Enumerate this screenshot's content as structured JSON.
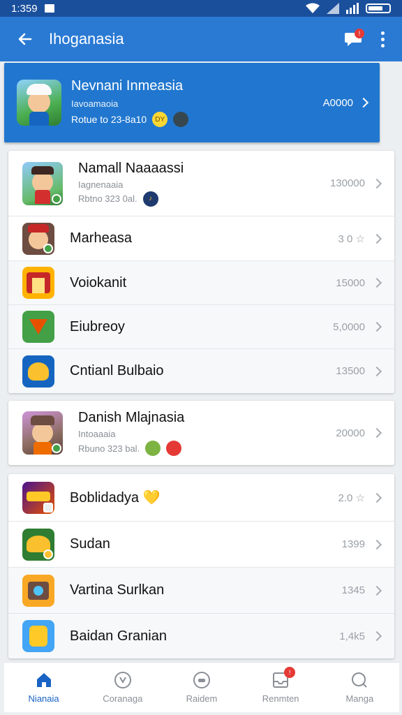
{
  "status_bar": {
    "time": "1:359"
  },
  "app_bar": {
    "title": "Ihoganasia",
    "notification_count": "!"
  },
  "featured": {
    "name": "Nevnani Inmeasia",
    "subtitle": "Iavoamaoia",
    "meta": "Rotue to 23-8a10",
    "value": "A0000"
  },
  "list_group_1": [
    {
      "name": "Namall Naaaassi",
      "subtitle": "Iagnenaaia",
      "meta": "Rbtno 323 0al.",
      "value": "130000"
    },
    {
      "name": "Marheasa",
      "value": "3 0 ☆"
    },
    {
      "name": "Voiokanit",
      "value": "15000"
    },
    {
      "name": "Eiubreoy",
      "value": "5,0000"
    },
    {
      "name": "Cntianl Bulbaio",
      "value": "13500"
    }
  ],
  "list_group_2": [
    {
      "name": "Danish Mlajnasia",
      "subtitle": "Intoaaaia",
      "meta": "Rbuno 323 bal.",
      "value": "20000"
    }
  ],
  "list_group_3": [
    {
      "name": "Boblidadya 💛",
      "value": "2.0 ☆"
    },
    {
      "name": "Sudan",
      "value": "1399"
    },
    {
      "name": "Vartina Surlkan",
      "value": "1345"
    },
    {
      "name": "Baidan Granian",
      "value": "1,4k5"
    }
  ],
  "bottom_nav": [
    {
      "label": "Nianaia",
      "icon": "home-icon",
      "active": true
    },
    {
      "label": "Coranaga",
      "icon": "compass-icon"
    },
    {
      "label": "Raidem",
      "icon": "gamepad-icon"
    },
    {
      "label": "Renmten",
      "icon": "inbox-icon",
      "badge": "!"
    },
    {
      "label": "Manga",
      "icon": "search-icon"
    }
  ],
  "colors": {
    "app_bar": "#2a7ad4",
    "status_bar": "#1a4f9c",
    "active_nav": "#1a63c4",
    "badge": "#e53935"
  }
}
